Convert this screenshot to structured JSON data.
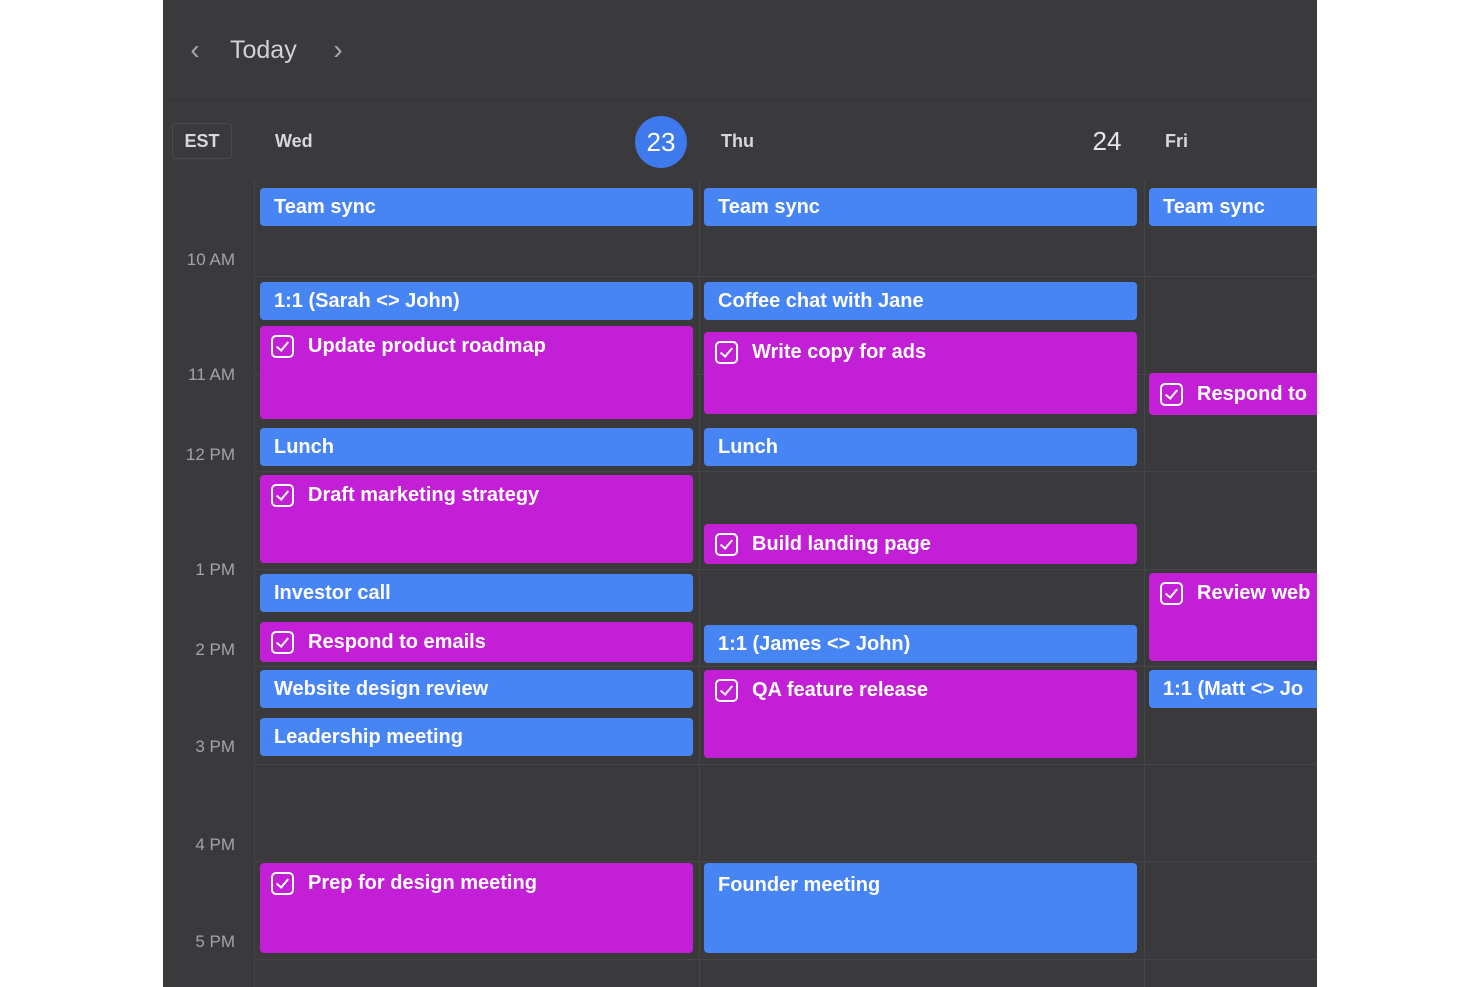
{
  "toolbar": {
    "prev": "‹",
    "today": "Today",
    "next": "›"
  },
  "timezone": "EST",
  "days": [
    {
      "name": "Wed",
      "number": "23",
      "is_today": true
    },
    {
      "name": "Thu",
      "number": "24",
      "is_today": false
    },
    {
      "name": "Fri",
      "number": "",
      "is_today": false
    }
  ],
  "time_labels": [
    "10 AM",
    "11 AM",
    "12 PM",
    "1 PM",
    "2 PM",
    "3 PM",
    "4 PM",
    "5 PM"
  ],
  "events": {
    "wed": [
      {
        "title": "Team sync",
        "kind": "meeting"
      },
      {
        "title": "1:1 (Sarah <> John)",
        "kind": "meeting"
      },
      {
        "title": "Update product roadmap",
        "kind": "task"
      },
      {
        "title": "Lunch",
        "kind": "meeting"
      },
      {
        "title": "Draft marketing strategy",
        "kind": "task"
      },
      {
        "title": "Investor call",
        "kind": "meeting"
      },
      {
        "title": "Respond to emails",
        "kind": "task"
      },
      {
        "title": "Website design review",
        "kind": "meeting"
      },
      {
        "title": "Leadership meeting",
        "kind": "meeting"
      },
      {
        "title": "Prep for design meeting",
        "kind": "task"
      }
    ],
    "thu": [
      {
        "title": "Team sync",
        "kind": "meeting"
      },
      {
        "title": "Coffee chat with Jane",
        "kind": "meeting"
      },
      {
        "title": "Write copy for ads",
        "kind": "task"
      },
      {
        "title": "Lunch",
        "kind": "meeting"
      },
      {
        "title": "Build landing page",
        "kind": "task"
      },
      {
        "title": "1:1 (James <> John)",
        "kind": "meeting"
      },
      {
        "title": "QA feature release",
        "kind": "task"
      },
      {
        "title": "Founder meeting",
        "kind": "meeting"
      }
    ],
    "fri": [
      {
        "title": "Team sync",
        "kind": "meeting"
      },
      {
        "title": "Respond to",
        "kind": "task"
      },
      {
        "title": "Review web",
        "kind": "task"
      },
      {
        "title": "1:1 (Matt <> Jo",
        "kind": "meeting"
      }
    ]
  },
  "colors": {
    "background": "#3a3a3c",
    "meeting": "#4784f4",
    "task": "#c31fd6",
    "today_badge": "#3f79ee"
  }
}
